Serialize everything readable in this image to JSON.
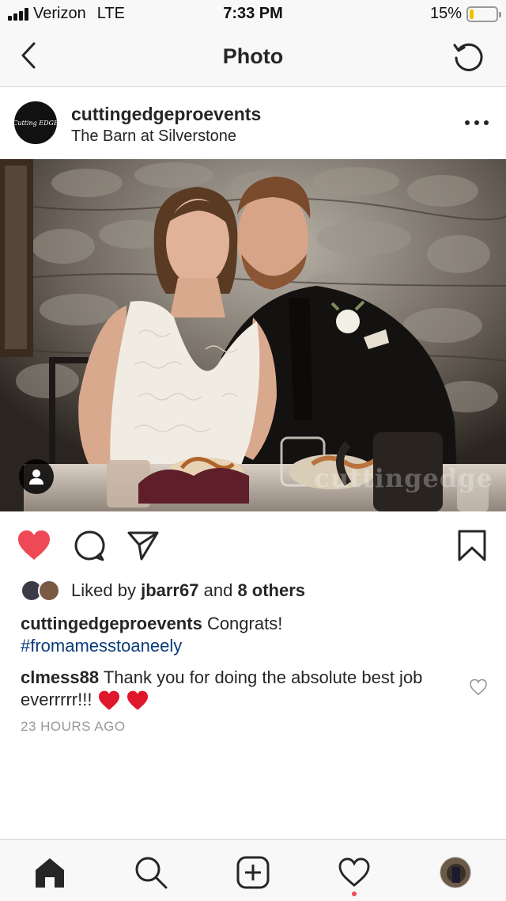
{
  "status_bar": {
    "carrier": "Verizon",
    "network": "LTE",
    "time": "7:33 PM",
    "battery_percent": "15%",
    "battery_level": 0.15
  },
  "header": {
    "title": "Photo",
    "back_icon": "chevron-left-icon",
    "refresh_icon": "refresh-icon"
  },
  "post": {
    "username": "cuttingedgeproevents",
    "location": "The Barn at Silverstone",
    "avatar_text": "Cutting EDGE",
    "photo_watermark": "cuttingedge",
    "liked": true,
    "likes": {
      "prefix": "Liked by",
      "first_user": "jbarr67",
      "connector": "and",
      "others": "8 others"
    },
    "caption": {
      "username": "cuttingedgeproevents",
      "text": "Congrats!",
      "hashtag": "#fromamesstoaneely"
    },
    "comment": {
      "username": "clmess88",
      "text": "Thank you for doing the absolute best job everrrrr!!!"
    },
    "timestamp": "23 HOURS AGO"
  },
  "colors": {
    "like_red": "#ed4956",
    "hashtag_blue": "#0b3b78",
    "battery_yellow": "#f2c200"
  },
  "bottom_nav": {
    "items": [
      "home-icon",
      "search-icon",
      "new-post-icon",
      "activity-icon",
      "profile-avatar"
    ]
  }
}
